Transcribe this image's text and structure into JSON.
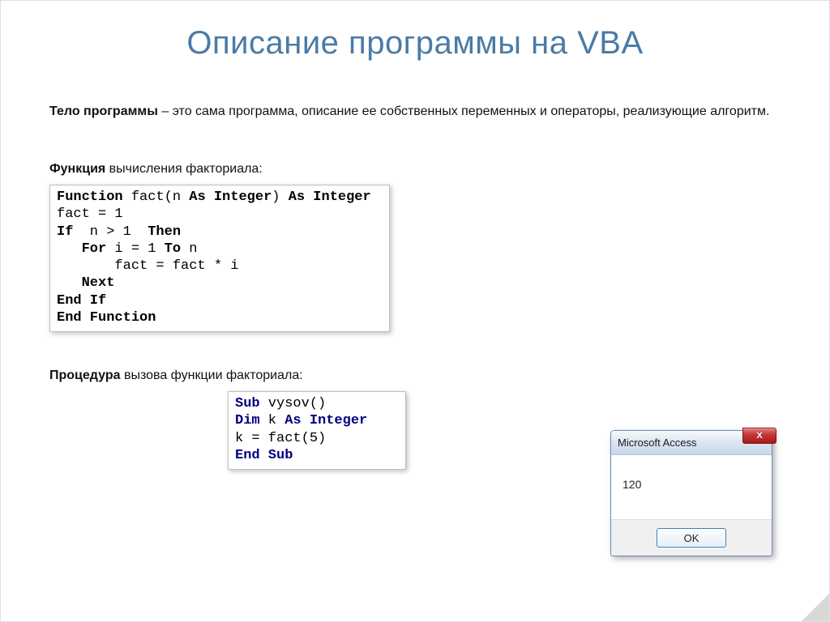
{
  "title": "Описание программы на VBA",
  "intro": {
    "strong": "Тело программы",
    "rest": " – это сама программа, описание ее собственных переменных и операторы, реализующие алгоритм."
  },
  "subhead1": {
    "strong": "Функция",
    "rest": " вычисления факториала:"
  },
  "code1": {
    "l1a": "Function",
    "l1b": " fact(n ",
    "l1c": "As Integer",
    "l1d": ") ",
    "l1e": "As Integer",
    "l2": "fact = 1",
    "l3a": "If",
    "l3b": "  n > 1  ",
    "l3c": "Then",
    "l4a": "   For",
    "l4b": " i = 1 ",
    "l4c": "To",
    "l4d": " n",
    "l5": "       fact = fact * i",
    "l6": "   Next",
    "l7": "End If",
    "l8": "End Function"
  },
  "subhead2": {
    "strong": "Процедура",
    "rest": " вызова функции факториала:"
  },
  "code2": {
    "l1a": "Sub",
    "l1b": " vysov()",
    "l2a": "Dim",
    "l2b": " k ",
    "l2c": "As Integer",
    "l3": "k = fact(5)",
    "l4": "End Sub"
  },
  "msgbox": {
    "title": "Microsoft Access",
    "close": "X",
    "value": "120",
    "ok": "OK"
  }
}
